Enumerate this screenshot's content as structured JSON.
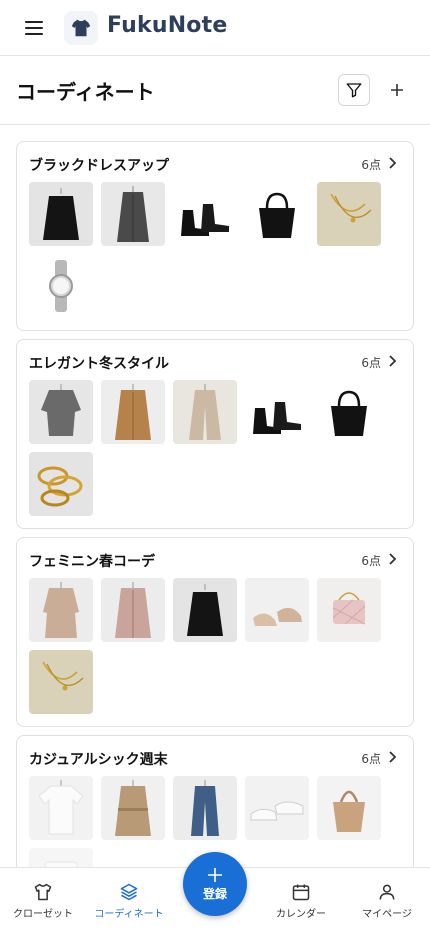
{
  "app": {
    "brand": "FukuNote"
  },
  "header": {
    "title": "コーディネート"
  },
  "icons": {
    "menu": "menu-icon",
    "logo": "shirt-logo-icon",
    "filter": "filter-icon",
    "add": "plus-icon",
    "chevron": "chevron-right-icon"
  },
  "colors": {
    "accent": "#1a6fd6",
    "brand_text": "#2e3f5c"
  },
  "outfits": [
    {
      "name": "ブラックドレスアップ",
      "count": "6点",
      "items": [
        "black-skirt",
        "gray-coat",
        "black-boots",
        "black-tote",
        "gold-necklace",
        "silver-watch"
      ]
    },
    {
      "name": "エレガント冬スタイル",
      "count": "6点",
      "items": [
        "gray-sweater",
        "camel-coat",
        "beige-wide-pants",
        "black-boots",
        "black-tote",
        "gold-chain-bracelets"
      ]
    },
    {
      "name": "フェミニン春コーデ",
      "count": "6点",
      "items": [
        "beige-knit-dress",
        "pink-cardigan",
        "black-skirt",
        "beige-pumps",
        "pink-quilted-bag",
        "gold-necklace"
      ]
    },
    {
      "name": "カジュアルシック週末",
      "count": "6点",
      "items": [
        "white-tshirt",
        "beige-trench-coat",
        "blue-jeans",
        "white-sneakers",
        "tan-shoulder-bag",
        "white-item"
      ]
    }
  ],
  "nav": {
    "closet": "クローゼット",
    "coordinate": "コーディネート",
    "register": "登録",
    "calendar": "カレンダー",
    "mypage": "マイページ",
    "active": "coordinate"
  }
}
